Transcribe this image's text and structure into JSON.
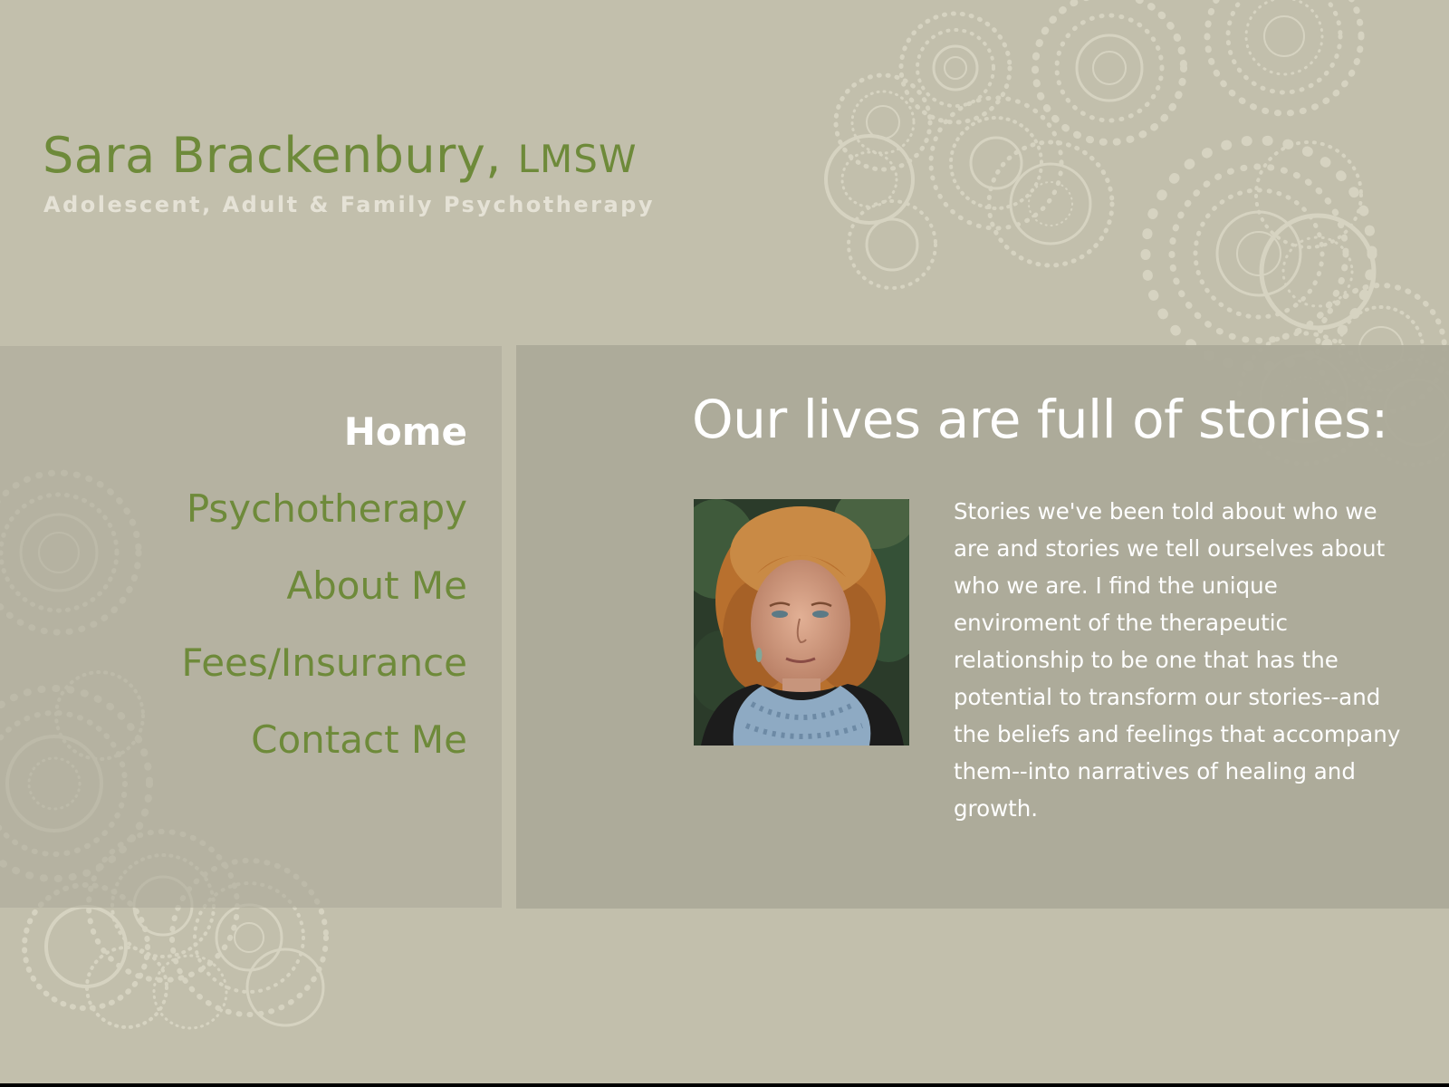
{
  "header": {
    "name": "Sara Brackenbury,",
    "credential": "LMSW",
    "tagline": "Adolescent, Adult & Family Psychotherapy"
  },
  "nav": {
    "items": [
      {
        "label": "Home",
        "active": true
      },
      {
        "label": "Psychotherapy",
        "active": false
      },
      {
        "label": "About Me",
        "active": false
      },
      {
        "label": "Fees/Insurance",
        "active": false
      },
      {
        "label": "Contact Me",
        "active": false
      }
    ]
  },
  "main": {
    "heading": "Our lives are full of stories:",
    "body": "Stories we've been told about who we are and stories we tell ourselves about who we are. I find the unique enviroment of the therapeutic relationship to be one that has the potential to transform our stories--and the beliefs and feelings that accompany them--into narratives of healing and growth."
  },
  "colors": {
    "background": "#c2bfac",
    "panel": "#acaa99",
    "accent_green": "#6e8a3a",
    "text_light": "#ffffff",
    "decor": "#dddac9"
  }
}
